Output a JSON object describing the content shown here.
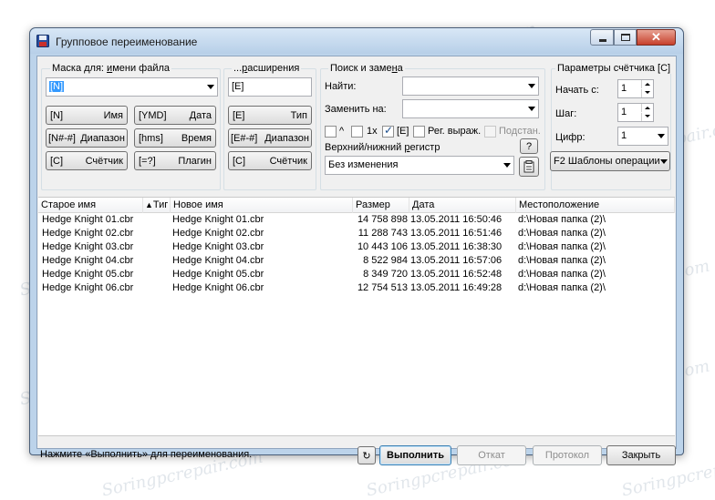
{
  "window": {
    "title": "Групповое переименование",
    "accent": "#bcd3ea"
  },
  "mask": {
    "group_label_pre": "Маска для: ",
    "group_label_u": "и",
    "group_label_post": "мени файла",
    "value": "[N]",
    "buttons": [
      {
        "code": "[N]",
        "text": "Имя"
      },
      {
        "code": "[YMD]",
        "text": "Дата"
      },
      {
        "code": "[N#-#]",
        "text": "Диапазон"
      },
      {
        "code": "[hms]",
        "text": "Время"
      },
      {
        "code": "[C]",
        "text": "Счётчик"
      },
      {
        "code": "[=?]",
        "text": "Плагин"
      }
    ]
  },
  "ext": {
    "group_label_pre": "...",
    "group_label_u": "р",
    "group_label_post": "асширения",
    "value": "[E]",
    "buttons": [
      {
        "code": "[E]",
        "text": "Тип"
      },
      {
        "code": "[E#-#]",
        "text": "Диапазон"
      },
      {
        "code": "[C]",
        "text": "Счётчик"
      }
    ]
  },
  "search": {
    "group_label_pre": "Поиск и заме",
    "group_label_u": "н",
    "group_label_post": "а",
    "find_label": "Найти:",
    "find_value": "",
    "replace_label": "Заменить на:",
    "replace_value": "",
    "opts": {
      "caret": "^",
      "once": "1x",
      "ext": "[E]",
      "regex": "Рег. выраж.",
      "subst": "Подстан."
    },
    "case_label_pre": "Верхний/нижний ",
    "case_label_u": "р",
    "case_label_post": "егистр",
    "case_value": "Без изменения",
    "help_btn": "?"
  },
  "counter": {
    "group_label": "Параметры счётчика [C]",
    "start_label": "Начать с:",
    "start_value": "1",
    "step_label": "Шаг:",
    "step_value": "1",
    "digits_label": "Цифр:",
    "digits_value": "1",
    "templates_value": "F2 Шаблоны операции"
  },
  "table": {
    "columns": {
      "old": "Старое имя",
      "type": "Тиг",
      "new": "Новое имя",
      "size": "Размер",
      "date": "Дата",
      "path": "Местоположение"
    },
    "rows": [
      {
        "old": "Hedge Knight 01.cbr",
        "new": "Hedge Knight 01.cbr",
        "size": "14 758 898",
        "date": "13.05.2011 16:50:46",
        "path": "d:\\Новая папка (2)\\"
      },
      {
        "old": "Hedge Knight 02.cbr",
        "new": "Hedge Knight 02.cbr",
        "size": "11 288 743",
        "date": "13.05.2011 16:51:46",
        "path": "d:\\Новая папка (2)\\"
      },
      {
        "old": "Hedge Knight 03.cbr",
        "new": "Hedge Knight 03.cbr",
        "size": "10 443 106",
        "date": "13.05.2011 16:38:30",
        "path": "d:\\Новая папка (2)\\"
      },
      {
        "old": "Hedge Knight 04.cbr",
        "new": "Hedge Knight 04.cbr",
        "size": "8 522 984",
        "date": "13.05.2011 16:57:06",
        "path": "d:\\Новая папка (2)\\"
      },
      {
        "old": "Hedge Knight 05.cbr",
        "new": "Hedge Knight 05.cbr",
        "size": "8 349 720",
        "date": "13.05.2011 16:52:48",
        "path": "d:\\Новая папка (2)\\"
      },
      {
        "old": "Hedge Knight 06.cbr",
        "new": "Hedge Knight 06.cbr",
        "size": "12 754 513",
        "date": "13.05.2011 16:49:28",
        "path": "d:\\Новая папка (2)\\"
      }
    ]
  },
  "status": {
    "text": "Нажмите «Выполнить» для переименования.",
    "run_btn": "Выполнить",
    "undo_btn": "Откат",
    "log_btn": "Протокол",
    "close_btn": "Закрыть"
  },
  "watermark": "Soringpcrepair.com"
}
